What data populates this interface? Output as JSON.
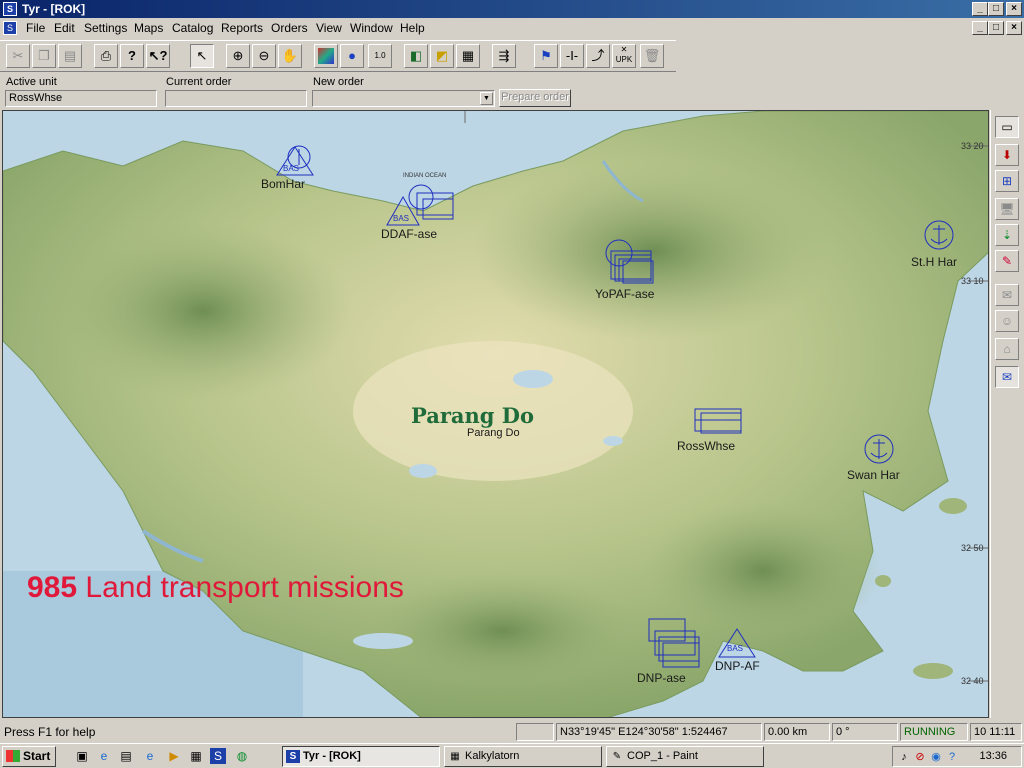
{
  "window": {
    "title": "Tyr - [ROK]",
    "app_icon": "S",
    "min_label": "_",
    "max_label": "□",
    "close_label": "×"
  },
  "menu": {
    "items": [
      "File",
      "Edit",
      "Settings",
      "Maps",
      "Catalog",
      "Reports",
      "Orders",
      "View",
      "Window",
      "Help"
    ]
  },
  "toolbar": {
    "icons": [
      "cut-icon",
      "copy-icon",
      "paste-icon",
      "print-icon",
      "help-icon",
      "context-help-icon",
      "pointer-icon",
      "zoom-in-icon",
      "zoom-out-icon",
      "pan-hand-icon",
      "map-layer-icon",
      "globe-icon",
      "scale-icon",
      "layers-icon",
      "overlay-icon",
      "grid-icon",
      "export-icon",
      "route-icon",
      "split-icon",
      "unit-task-icon",
      "unpack-icon",
      "delete-icon"
    ],
    "scale_label": "1.0",
    "upk_label": "UPK"
  },
  "order_bar": {
    "active_unit_label": "Active unit",
    "active_unit_value": "RossWhse",
    "current_order_label": "Current order",
    "current_order_value": "",
    "new_order_label": "New order",
    "new_order_value": "",
    "prepare_button": "Prepare order"
  },
  "map": {
    "title_label": "Parang Do",
    "sub_label": "Parang Do",
    "overlay_count": "985",
    "overlay_text": "Land transport missions",
    "coords": [
      "33 20",
      "33 10",
      "32 50",
      "32 40"
    ],
    "sea_label": "INDIAN OCEAN",
    "units": [
      {
        "label": "BomHar"
      },
      {
        "label": "DDAF-ase"
      },
      {
        "label": "YoPAF-ase"
      },
      {
        "label": "St.H Har"
      },
      {
        "label": "RossWhse"
      },
      {
        "label": "Swan Har"
      },
      {
        "label": "DNP-AF"
      },
      {
        "label": "DNP-ase"
      }
    ]
  },
  "status": {
    "help_text": "Press F1 for help",
    "position": "N33°19'45\" E124°30'58\"",
    "scale": "1:524467",
    "distance": "0.00 km",
    "bearing": "0 °",
    "state": "RUNNING",
    "time": "10 11:11"
  },
  "taskbar": {
    "start_label": "Start",
    "tasks": [
      "Tyr - [ROK]",
      "Kalkylatorn",
      "COP_1 - Paint"
    ],
    "clock": "13:36"
  },
  "colors": {
    "title_bar": "#0a246a",
    "unit_blue": "#1f2fbf",
    "overlay_red": "#e0193a",
    "running_green": "#006400"
  }
}
